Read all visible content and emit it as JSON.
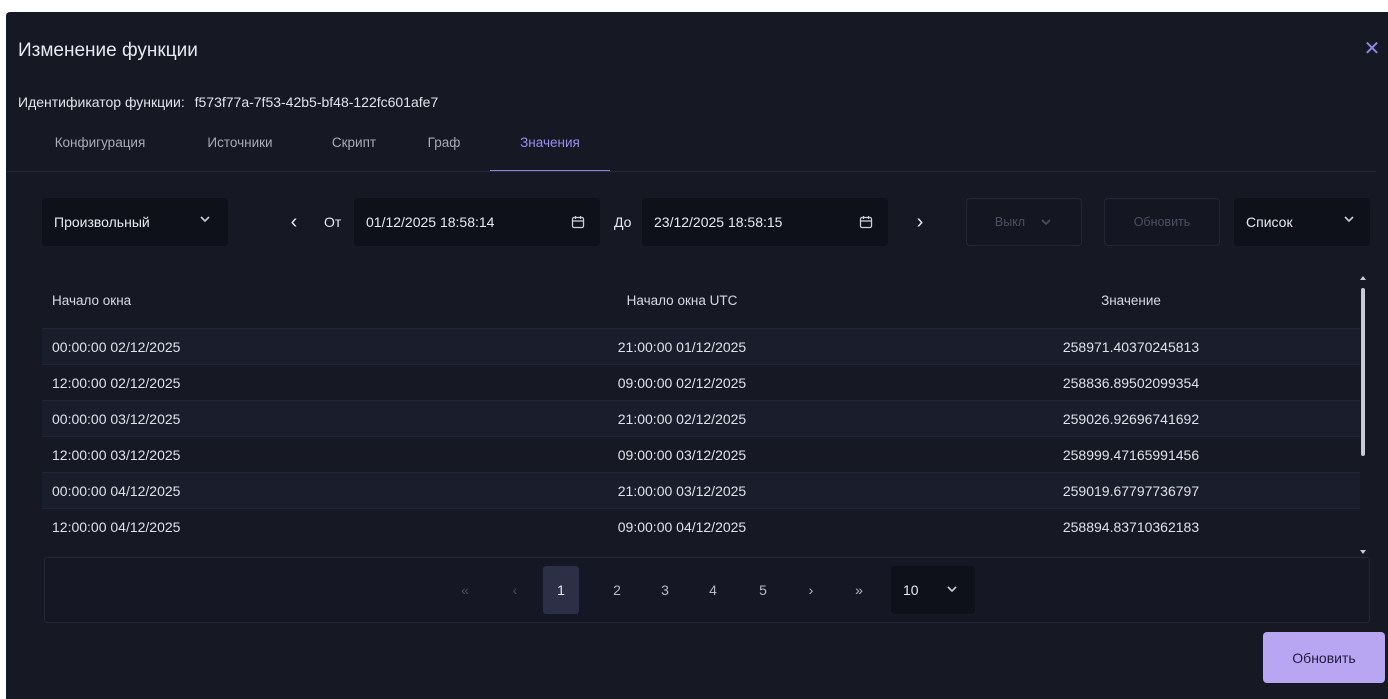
{
  "modal": {
    "title": "Изменение функции",
    "close_icon": "close-icon"
  },
  "function_id": {
    "label": "Идентификатор функции:",
    "value": "f573f77a-7f53-42b5-bf48-122fc601afe7"
  },
  "tabs": [
    {
      "label": "Конфигурация",
      "active": false
    },
    {
      "label": "Источники",
      "active": false
    },
    {
      "label": "Скрипт",
      "active": false
    },
    {
      "label": "Граф",
      "active": false
    },
    {
      "label": "Значения",
      "active": true
    }
  ],
  "toolbar": {
    "range_select": "Произвольный",
    "from_label": "От",
    "from_value": "01/12/2025 18:58:14",
    "to_label": "До",
    "to_value": "23/12/2025 18:58:15",
    "auto_refresh": "Выкл",
    "refresh_label": "Обновить",
    "view_mode": "Список"
  },
  "table": {
    "columns": [
      "Начало окна",
      "Начало окна UTC",
      "Значение"
    ],
    "rows": [
      [
        "00:00:00 02/12/2025",
        "21:00:00 01/12/2025",
        "258971.40370245813"
      ],
      [
        "12:00:00 02/12/2025",
        "09:00:00 02/12/2025",
        "258836.89502099354"
      ],
      [
        "00:00:00 03/12/2025",
        "21:00:00 02/12/2025",
        "259026.92696741692"
      ],
      [
        "12:00:00 03/12/2025",
        "09:00:00 03/12/2025",
        "258999.47165991456"
      ],
      [
        "00:00:00 04/12/2025",
        "21:00:00 03/12/2025",
        "259019.67797736797"
      ],
      [
        "12:00:00 04/12/2025",
        "09:00:00 04/12/2025",
        "258894.83710362183"
      ]
    ]
  },
  "pagination": {
    "first": "«",
    "prev": "‹",
    "pages": [
      "1",
      "2",
      "3",
      "4",
      "5"
    ],
    "current": "1",
    "next": "›",
    "last": "»",
    "page_size": "10"
  },
  "footer": {
    "save_label": "Обновить"
  },
  "colors": {
    "accent": "#8e84e8",
    "primary_button": "#b8a6f2",
    "background": "#161824"
  }
}
